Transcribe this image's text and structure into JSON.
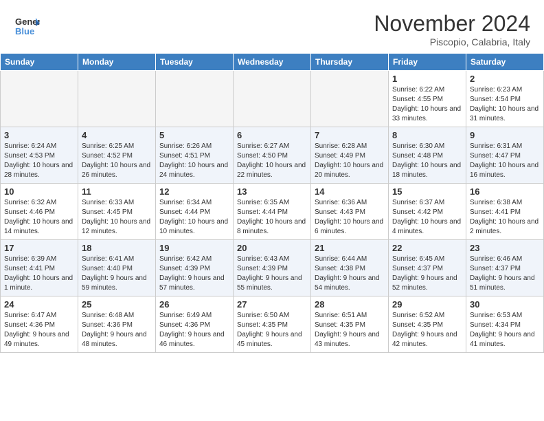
{
  "header": {
    "logo_line1": "General",
    "logo_line2": "Blue",
    "month": "November 2024",
    "location": "Piscopio, Calabria, Italy"
  },
  "weekdays": [
    "Sunday",
    "Monday",
    "Tuesday",
    "Wednesday",
    "Thursday",
    "Friday",
    "Saturday"
  ],
  "weeks": [
    [
      {
        "day": "",
        "info": ""
      },
      {
        "day": "",
        "info": ""
      },
      {
        "day": "",
        "info": ""
      },
      {
        "day": "",
        "info": ""
      },
      {
        "day": "",
        "info": ""
      },
      {
        "day": "1",
        "info": "Sunrise: 6:22 AM\nSunset: 4:55 PM\nDaylight: 10 hours and 33 minutes."
      },
      {
        "day": "2",
        "info": "Sunrise: 6:23 AM\nSunset: 4:54 PM\nDaylight: 10 hours and 31 minutes."
      }
    ],
    [
      {
        "day": "3",
        "info": "Sunrise: 6:24 AM\nSunset: 4:53 PM\nDaylight: 10 hours and 28 minutes."
      },
      {
        "day": "4",
        "info": "Sunrise: 6:25 AM\nSunset: 4:52 PM\nDaylight: 10 hours and 26 minutes."
      },
      {
        "day": "5",
        "info": "Sunrise: 6:26 AM\nSunset: 4:51 PM\nDaylight: 10 hours and 24 minutes."
      },
      {
        "day": "6",
        "info": "Sunrise: 6:27 AM\nSunset: 4:50 PM\nDaylight: 10 hours and 22 minutes."
      },
      {
        "day": "7",
        "info": "Sunrise: 6:28 AM\nSunset: 4:49 PM\nDaylight: 10 hours and 20 minutes."
      },
      {
        "day": "8",
        "info": "Sunrise: 6:30 AM\nSunset: 4:48 PM\nDaylight: 10 hours and 18 minutes."
      },
      {
        "day": "9",
        "info": "Sunrise: 6:31 AM\nSunset: 4:47 PM\nDaylight: 10 hours and 16 minutes."
      }
    ],
    [
      {
        "day": "10",
        "info": "Sunrise: 6:32 AM\nSunset: 4:46 PM\nDaylight: 10 hours and 14 minutes."
      },
      {
        "day": "11",
        "info": "Sunrise: 6:33 AM\nSunset: 4:45 PM\nDaylight: 10 hours and 12 minutes."
      },
      {
        "day": "12",
        "info": "Sunrise: 6:34 AM\nSunset: 4:44 PM\nDaylight: 10 hours and 10 minutes."
      },
      {
        "day": "13",
        "info": "Sunrise: 6:35 AM\nSunset: 4:44 PM\nDaylight: 10 hours and 8 minutes."
      },
      {
        "day": "14",
        "info": "Sunrise: 6:36 AM\nSunset: 4:43 PM\nDaylight: 10 hours and 6 minutes."
      },
      {
        "day": "15",
        "info": "Sunrise: 6:37 AM\nSunset: 4:42 PM\nDaylight: 10 hours and 4 minutes."
      },
      {
        "day": "16",
        "info": "Sunrise: 6:38 AM\nSunset: 4:41 PM\nDaylight: 10 hours and 2 minutes."
      }
    ],
    [
      {
        "day": "17",
        "info": "Sunrise: 6:39 AM\nSunset: 4:41 PM\nDaylight: 10 hours and 1 minute."
      },
      {
        "day": "18",
        "info": "Sunrise: 6:41 AM\nSunset: 4:40 PM\nDaylight: 9 hours and 59 minutes."
      },
      {
        "day": "19",
        "info": "Sunrise: 6:42 AM\nSunset: 4:39 PM\nDaylight: 9 hours and 57 minutes."
      },
      {
        "day": "20",
        "info": "Sunrise: 6:43 AM\nSunset: 4:39 PM\nDaylight: 9 hours and 55 minutes."
      },
      {
        "day": "21",
        "info": "Sunrise: 6:44 AM\nSunset: 4:38 PM\nDaylight: 9 hours and 54 minutes."
      },
      {
        "day": "22",
        "info": "Sunrise: 6:45 AM\nSunset: 4:37 PM\nDaylight: 9 hours and 52 minutes."
      },
      {
        "day": "23",
        "info": "Sunrise: 6:46 AM\nSunset: 4:37 PM\nDaylight: 9 hours and 51 minutes."
      }
    ],
    [
      {
        "day": "24",
        "info": "Sunrise: 6:47 AM\nSunset: 4:36 PM\nDaylight: 9 hours and 49 minutes."
      },
      {
        "day": "25",
        "info": "Sunrise: 6:48 AM\nSunset: 4:36 PM\nDaylight: 9 hours and 48 minutes."
      },
      {
        "day": "26",
        "info": "Sunrise: 6:49 AM\nSunset: 4:36 PM\nDaylight: 9 hours and 46 minutes."
      },
      {
        "day": "27",
        "info": "Sunrise: 6:50 AM\nSunset: 4:35 PM\nDaylight: 9 hours and 45 minutes."
      },
      {
        "day": "28",
        "info": "Sunrise: 6:51 AM\nSunset: 4:35 PM\nDaylight: 9 hours and 43 minutes."
      },
      {
        "day": "29",
        "info": "Sunrise: 6:52 AM\nSunset: 4:35 PM\nDaylight: 9 hours and 42 minutes."
      },
      {
        "day": "30",
        "info": "Sunrise: 6:53 AM\nSunset: 4:34 PM\nDaylight: 9 hours and 41 minutes."
      }
    ]
  ]
}
